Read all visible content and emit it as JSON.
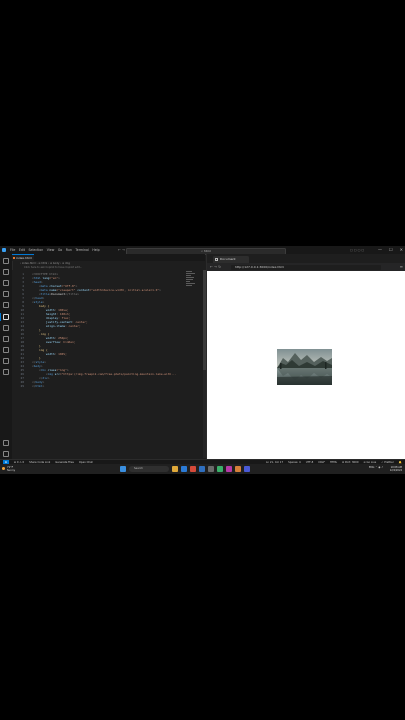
{
  "window": {
    "menu": [
      "File",
      "Edit",
      "Selection",
      "View",
      "Go",
      "Run",
      "Terminal",
      "Help"
    ],
    "nav_arrows": "← →",
    "search": "⌕ html",
    "layout_icons": "▢ ▢ ▢ ▢",
    "controls": {
      "minimize": "—",
      "maximize": "☐",
      "close": "✕"
    }
  },
  "editor": {
    "tab_label": "index.html",
    "breadcrumb": "› index.html › ⊘ html › ⊘ body › ⊘ img",
    "hint": "Click here to ask Copilot to have Copilot edit...",
    "accent": "#0078d4"
  },
  "code": {
    "l1": {
      "n": "1",
      "t": "<!DOCTYPE html>"
    },
    "l2": {
      "n": "2",
      "a": "<",
      "b": "html",
      "c": " lang",
      "d": "=\"en\"",
      "e": ">"
    },
    "l3": {
      "n": "3",
      "a": "<",
      "b": "head",
      "e": ">"
    },
    "l4": {
      "n": "4",
      "a": "    <",
      "b": "meta",
      "c": " charset",
      "d": "=\"UTF-8\"",
      "e": ">"
    },
    "l5": {
      "n": "5",
      "a": "    <",
      "b": "meta",
      "c": " name",
      "d": "=\"viewport\"",
      "f": " content",
      "g": "=\"width=device-width, initial-scale=1.0\"",
      "e": ">"
    },
    "l6": {
      "n": "6",
      "a": "    <",
      "b": "title",
      "e": ">",
      "t": "Document",
      "z": "</title>"
    },
    "l7": {
      "n": "7",
      "a": "</",
      "b": "head",
      "e": ">"
    },
    "l8": {
      "n": "8",
      "a": "<",
      "b": "style",
      "e": ">"
    },
    "l9": {
      "n": "9",
      "s": "    body {"
    },
    "l10": {
      "n": "10",
      "p": "        width",
      "v": ": 100vw;"
    },
    "l11": {
      "n": "11",
      "p": "        height",
      "v": ": 100vh;"
    },
    "l12": {
      "n": "12",
      "p": "        display",
      "v": ": flex;"
    },
    "l13": {
      "n": "13",
      "p": "        justify-content",
      "v": ": center;"
    },
    "l14": {
      "n": "14",
      "p": "        align-items",
      "v": ": center;"
    },
    "l15": {
      "n": "15",
      "s": "    }"
    },
    "l16": {
      "n": "16",
      "s": "    .img {"
    },
    "l17": {
      "n": "17",
      "p": "        width",
      "v": ": 250px;"
    },
    "l18": {
      "n": "18",
      "p": "        overflow",
      "v": ": hidden;"
    },
    "l19": {
      "n": "19",
      "s": "    }"
    },
    "l20": {
      "n": "20",
      "s": "    img {"
    },
    "l21": {
      "n": "21",
      "p": "        width",
      "v": ": 100%;"
    },
    "l22": {
      "n": "22",
      "s": "    }"
    },
    "l23": {
      "n": "23",
      "a": "</",
      "b": "style",
      "e": ">"
    },
    "l24": {
      "n": "24",
      "a": "<",
      "b": "body",
      "e": ">"
    },
    "l25": {
      "n": "25",
      "a": "    <",
      "b": "div",
      "c": " class",
      "d": "=\"img\"",
      "e": ">"
    },
    "l26": {
      "n": "26",
      "a": "        <",
      "b": "img",
      "c": " src",
      "d": "=\"https://img.freepik.com/free-photo/painting-mountain-lake-with...",
      "e": ""
    },
    "l27": {
      "n": "27",
      "a": "    </",
      "b": "div",
      "e": ">"
    },
    "l28": {
      "n": "28",
      "a": "</",
      "b": "body",
      "e": ">"
    },
    "l29": {
      "n": "29",
      "a": "</",
      "b": "html",
      "e": ">"
    }
  },
  "browser": {
    "tab_label": "Document",
    "url": "http://127.0.0.1:3000/index.html",
    "nav": "← → ↻",
    "menu": "≡"
  },
  "statusbar": {
    "remote": "⧉",
    "problems": "⊗ 0 ⚠ 0",
    "share": "Share Code Link",
    "explain": "Generate Files",
    "open": "Open Chat",
    "cursor_pos": "Ln 21, Col 17",
    "spaces": "Spaces: 4",
    "encoding": "UTF-8",
    "eol": "CRLF",
    "lang": "HTML",
    "port": "⊚ Port: 3000",
    "golive": "⊘ Go Live",
    "prettier": "✓ Prettier",
    "bell": "🔔"
  },
  "taskbar": {
    "temp": "71°F",
    "condition": "Sunny",
    "search": "Search",
    "tray": "ENG ⌃ ◉ ♪",
    "time": "10:08 AM",
    "date": "12/2/2024"
  }
}
